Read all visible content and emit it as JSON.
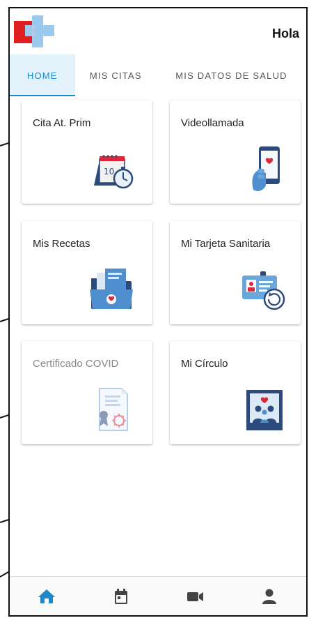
{
  "header": {
    "greeting": "Hola"
  },
  "tabs": [
    {
      "label": "HOME",
      "active": true
    },
    {
      "label": "MIS CITAS",
      "active": false
    },
    {
      "label": "MIS DATOS DE SALUD",
      "active": false
    }
  ],
  "cards": [
    {
      "label": "Cita At. Prim",
      "icon": "calendar-timer-icon",
      "enabled": true
    },
    {
      "label": "Videollamada",
      "icon": "phone-heart-icon",
      "enabled": true
    },
    {
      "label": "Mis Recetas",
      "icon": "folder-heart-icon",
      "enabled": true
    },
    {
      "label": "Mi Tarjeta Sanitaria",
      "icon": "id-card-refresh-icon",
      "enabled": true
    },
    {
      "label": "Certificado COVID",
      "icon": "certificate-virus-icon",
      "enabled": false
    },
    {
      "label": "Mi Círculo",
      "icon": "family-photo-icon",
      "enabled": true
    }
  ],
  "bottom_nav": [
    {
      "icon": "home-icon",
      "active": true
    },
    {
      "icon": "calendar-icon",
      "active": false
    },
    {
      "icon": "video-camera-icon",
      "active": false
    },
    {
      "icon": "person-icon",
      "active": false
    }
  ],
  "colors": {
    "accent": "#1e88c9",
    "tab_active_bg": "#e3f1fb",
    "logo_red": "#e02020",
    "logo_blue": "#9cc9ee",
    "illus_navy": "#2c4a7c",
    "illus_blue": "#4f8fd0",
    "heart_red": "#d8283a",
    "nav_grey": "#444444"
  }
}
